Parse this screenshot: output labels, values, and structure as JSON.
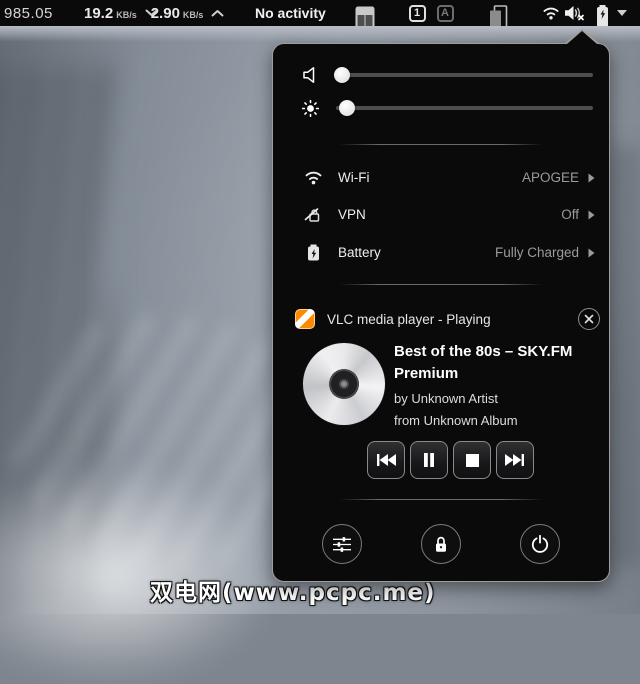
{
  "colors": {
    "topbar_bg": "#0a0a0a",
    "panel_bg": "#0a0a0b",
    "panel_border": "#9e9e9e",
    "label_text": "#eeeeee",
    "value_text": "#9b9b9b",
    "vlc_orange": "#ff8a00"
  },
  "topbar": {
    "monitor_value": "985.05",
    "net": {
      "down_value": "19.2",
      "down_unit": "KB/s",
      "up_value": "2.90",
      "up_unit": "KB/s"
    },
    "activity_label": "No activity",
    "workspace_indicator": "1",
    "input_indicator": "A",
    "status_icons": [
      "touchpad-icon",
      "workspace-indicator",
      "input-method-indicator",
      "windows-overview-icon",
      "wifi-icon",
      "volume-muted-icon",
      "battery-charging-icon",
      "menu-caret-icon"
    ]
  },
  "menu": {
    "sliders": [
      {
        "name": "volume",
        "icon": "speaker-muted-icon",
        "value_pct": 0
      },
      {
        "name": "brightness",
        "icon": "brightness-icon",
        "value_pct": 2
      }
    ],
    "items": [
      {
        "icon": "wifi-icon",
        "label": "Wi-Fi",
        "value": "APOGEE"
      },
      {
        "icon": "vpn-lock-icon",
        "label": "VPN",
        "value": "Off"
      },
      {
        "icon": "battery-icon",
        "label": "Battery",
        "value": "Fully Charged"
      }
    ],
    "media": {
      "app_header": "VLC media player - Playing",
      "track_title": "Best of the 80s – SKY.FM Premium",
      "artist_line": "by Unknown Artist",
      "album_line": "from Unknown Album",
      "controls": [
        "previous",
        "pause",
        "stop",
        "next"
      ]
    },
    "system_buttons": [
      "settings",
      "lock",
      "power"
    ]
  },
  "watermark": "双电网(www.pcpc.me)"
}
